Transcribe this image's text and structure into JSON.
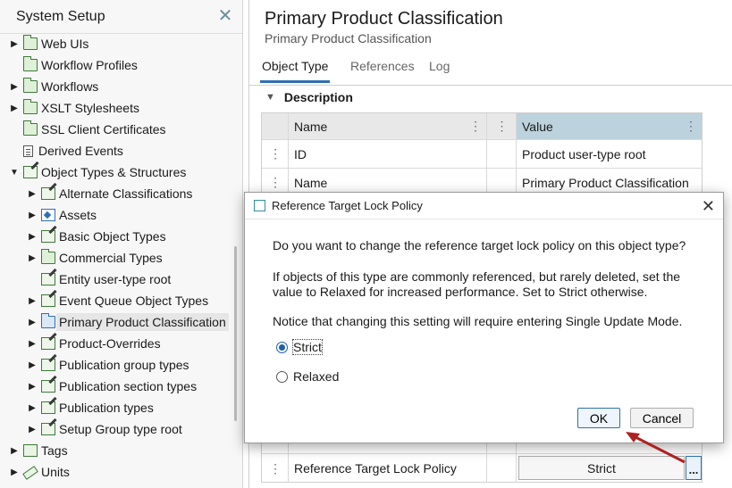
{
  "left_panel": {
    "title": "System Setup",
    "items": [
      {
        "label": "Web UIs",
        "caret": "▶",
        "icon": "green-folder-icon"
      },
      {
        "label": "Workflow Profiles",
        "caret": "",
        "icon": "green-folder-icon"
      },
      {
        "label": "Workflows",
        "caret": "▶",
        "icon": "green-folder-icon"
      },
      {
        "label": "XSLT Stylesheets",
        "caret": "▶",
        "icon": "green-folder-icon"
      },
      {
        "label": "SSL Client Certificates",
        "caret": "",
        "icon": "green-folder-icon"
      },
      {
        "label": "Derived Events",
        "caret": "",
        "icon": "document-icon"
      },
      {
        "label": "Object Types & Structures",
        "caret": "▼",
        "icon": "edit-icon"
      },
      {
        "label": "Alternate Classifications",
        "caret": "▶",
        "icon": "edit-icon"
      },
      {
        "label": "Assets",
        "caret": "▶",
        "icon": "assets-icon"
      },
      {
        "label": "Basic Object Types",
        "caret": "▶",
        "icon": "edit-icon"
      },
      {
        "label": "Commercial Types",
        "caret": "▶",
        "icon": "green-folder-icon"
      },
      {
        "label": "Entity user-type root",
        "caret": "",
        "icon": "edit-icon"
      },
      {
        "label": "Event Queue Object Types",
        "caret": "▶",
        "icon": "edit-icon"
      },
      {
        "label": "Primary Product Classification",
        "caret": "▶",
        "icon": "blue-folder-icon"
      },
      {
        "label": "Product-Overrides",
        "caret": "▶",
        "icon": "edit-icon"
      },
      {
        "label": "Publication group types",
        "caret": "▶",
        "icon": "edit-icon"
      },
      {
        "label": "Publication section types",
        "caret": "▶",
        "icon": "edit-icon"
      },
      {
        "label": "Publication types",
        "caret": "▶",
        "icon": "edit-icon"
      },
      {
        "label": "Setup Group type root",
        "caret": "▶",
        "icon": "edit-icon"
      },
      {
        "label": "Tags",
        "caret": "▶",
        "icon": "tags-icon"
      },
      {
        "label": "Units",
        "caret": "▶",
        "icon": "units-icon"
      }
    ]
  },
  "main": {
    "title": "Primary Product Classification",
    "subtitle": "Primary Product Classification",
    "tabs": [
      {
        "label": "Object Type"
      },
      {
        "label": "References"
      },
      {
        "label": "Log"
      }
    ],
    "section_label": "Description",
    "grid": {
      "headers": {
        "name": "Name",
        "value": "Value"
      },
      "rows": [
        {
          "name": "ID",
          "value": "Product user-type root"
        },
        {
          "name": "Name",
          "value": "Primary Product Classification"
        }
      ],
      "last_row": {
        "name": "Reference Target Lock Policy",
        "value": "Strict",
        "button": "..."
      }
    }
  },
  "dialog": {
    "title": "Reference Target Lock Policy",
    "question": "Do you want to change the reference target lock policy on this object type?",
    "info_line1": "If objects of this type are commonly referenced, but rarely deleted, set the",
    "info_line2": "value to Relaxed for increased performance. Set to Strict otherwise.",
    "notice": "Notice that changing this setting will require entering Single Update Mode.",
    "options": [
      {
        "label": "Strict",
        "checked": true
      },
      {
        "label": "Relaxed",
        "checked": false
      }
    ],
    "ok_label": "OK",
    "cancel_label": "Cancel"
  },
  "colors": {
    "accent": "#2f6fb3",
    "header_value_bg": "#bcd2dc",
    "annotation_arrow": "#b02020"
  }
}
